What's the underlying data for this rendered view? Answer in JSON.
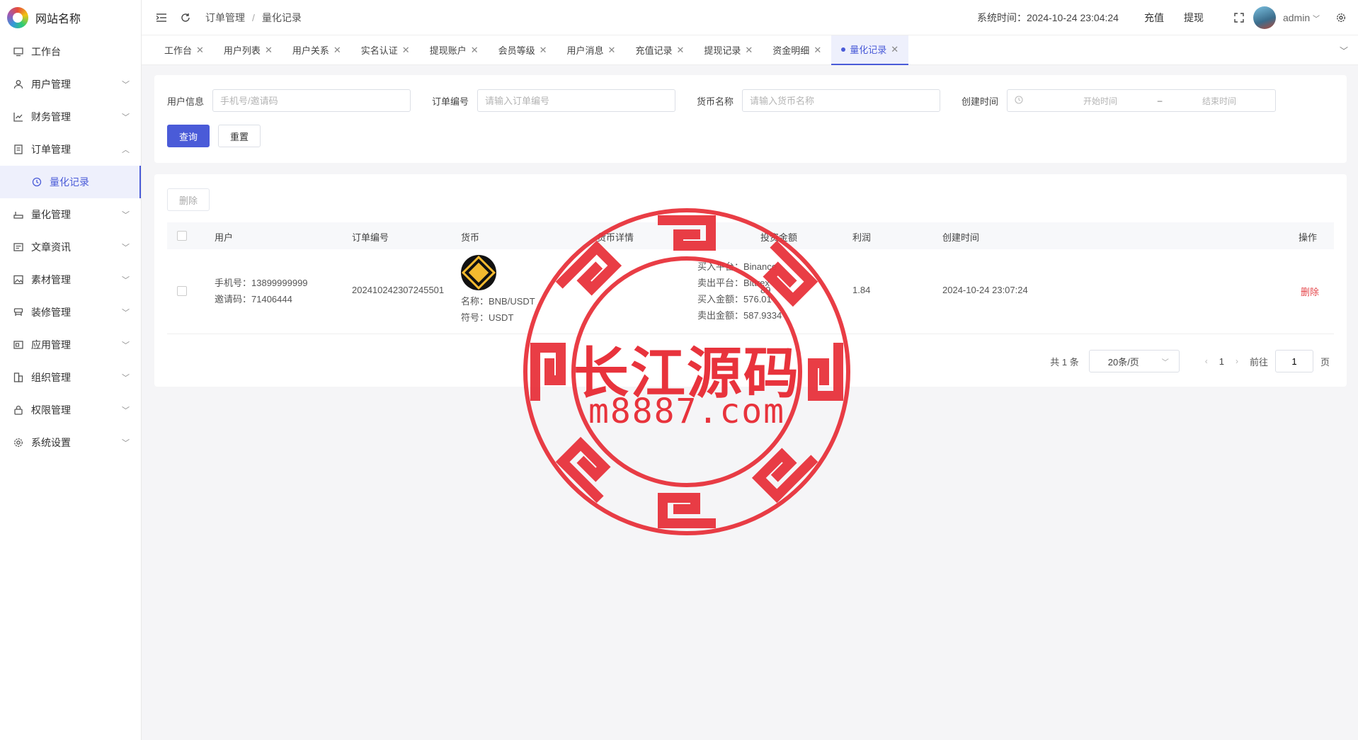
{
  "app": {
    "site_name": "网站名称"
  },
  "sidebar": {
    "items": [
      {
        "label": "工作台",
        "icon": "monitor-icon",
        "expandable": false
      },
      {
        "label": "用户管理",
        "icon": "user-icon",
        "expandable": true
      },
      {
        "label": "财务管理",
        "icon": "chart-icon",
        "expandable": true
      },
      {
        "label": "订单管理",
        "icon": "order-icon",
        "expandable": true,
        "expanded": true
      },
      {
        "label": "量化记录",
        "icon": "clock-icon",
        "sub": true,
        "active": true
      },
      {
        "label": "量化管理",
        "icon": "quant-icon",
        "expandable": true
      },
      {
        "label": "文章资讯",
        "icon": "article-icon",
        "expandable": true
      },
      {
        "label": "素材管理",
        "icon": "image-icon",
        "expandable": true
      },
      {
        "label": "装修管理",
        "icon": "decor-icon",
        "expandable": true
      },
      {
        "label": "应用管理",
        "icon": "app-icon",
        "expandable": true
      },
      {
        "label": "组织管理",
        "icon": "org-icon",
        "expandable": true
      },
      {
        "label": "权限管理",
        "icon": "lock-icon",
        "expandable": true
      },
      {
        "label": "系统设置",
        "icon": "gear-icon",
        "expandable": true
      }
    ]
  },
  "header": {
    "breadcrumb": [
      "订单管理",
      "量化记录"
    ],
    "system_time_label": "系统时间：2024-10-24 23:04:24",
    "recharge": "充值",
    "withdraw": "提现",
    "user": "admin"
  },
  "tabs": [
    {
      "label": "工作台"
    },
    {
      "label": "用户列表"
    },
    {
      "label": "用户关系"
    },
    {
      "label": "实名认证"
    },
    {
      "label": "提现账户"
    },
    {
      "label": "会员等级"
    },
    {
      "label": "用户消息"
    },
    {
      "label": "充值记录"
    },
    {
      "label": "提现记录"
    },
    {
      "label": "资金明细"
    },
    {
      "label": "量化记录",
      "active": true
    }
  ],
  "filter": {
    "user_label": "用户信息",
    "user_placeholder": "手机号/邀请码",
    "order_label": "订单编号",
    "order_placeholder": "请输入订单编号",
    "coin_label": "货币名称",
    "coin_placeholder": "请输入货币名称",
    "time_label": "创建时间",
    "start_placeholder": "开始时间",
    "range_sep": "–",
    "end_placeholder": "结束时间",
    "query": "查询",
    "reset": "重置"
  },
  "table": {
    "delete_button": "删除",
    "columns": [
      "用户",
      "订单编号",
      "货币",
      "货币详情",
      "投资金额",
      "利润",
      "创建时间",
      "操作"
    ],
    "rows": [
      {
        "phone": "手机号：13899999999",
        "invite": "邀请码：71406444",
        "order_no": "202410242307245501",
        "coin_name": "名称：BNB/USDT",
        "coin_symbol": "符号：USDT",
        "buy_platform": "买入平台：Binance",
        "sell_platform": "卖出平台：Bittrex",
        "buy_amount": "买入金额：576.01",
        "sell_amount": "卖出金额：587.9334",
        "invest": "89",
        "profit": "1.84",
        "created": "2024-10-24 23:07:24",
        "action": "删除"
      }
    ]
  },
  "pagination": {
    "total": "共 1 条",
    "page_size": "20条/页",
    "current": "1",
    "goto": "前往",
    "goto_value": "1",
    "page_unit": "页"
  },
  "watermark": {
    "line1": "长江源码",
    "line2": "m8887.com",
    "color": "#e8333c"
  },
  "colors": {
    "primary": "#4a5bd8",
    "danger": "#e5484d"
  }
}
